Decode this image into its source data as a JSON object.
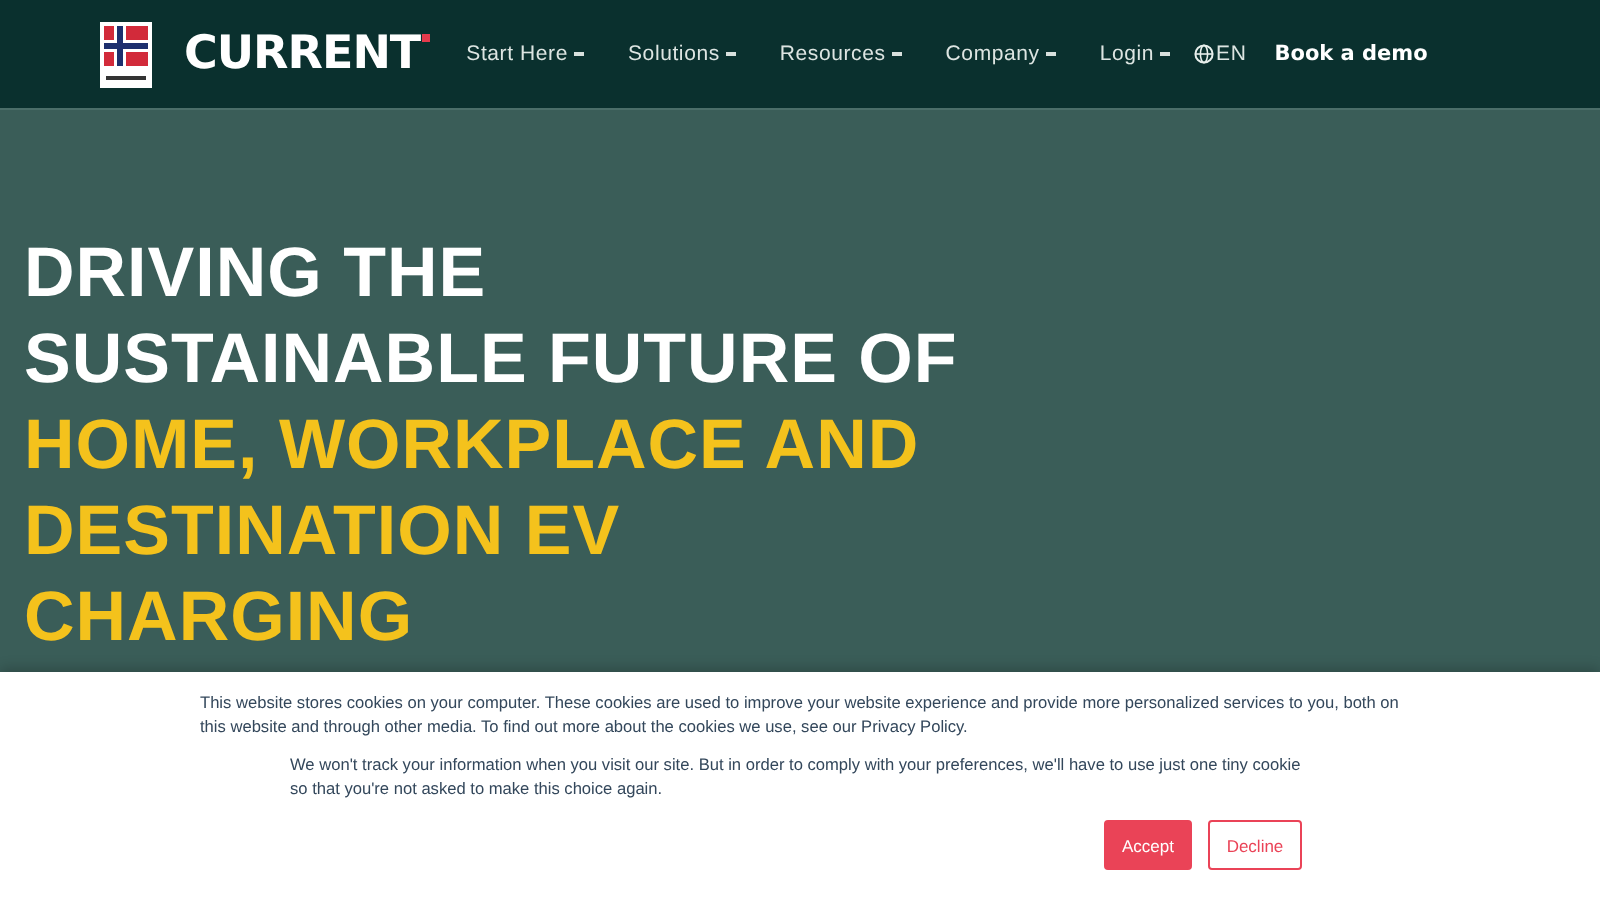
{
  "header": {
    "logo": "CURRENT",
    "nav": [
      {
        "label": "Start Here",
        "dropdown": true
      },
      {
        "label": "Solutions",
        "dropdown": true
      },
      {
        "label": "Resources",
        "dropdown": true
      },
      {
        "label": "Company",
        "dropdown": true
      },
      {
        "label": "Login",
        "dropdown": true
      }
    ],
    "language": "EN",
    "cta": "Book a demo"
  },
  "hero": {
    "lines": [
      {
        "text": "DRIVING THE",
        "highlight": false
      },
      {
        "text": "SUSTAINABLE FUTURE OF",
        "highlight": false
      },
      {
        "text": "HOME, WORKPLACE AND",
        "highlight": true
      },
      {
        "text": "DESTINATION EV",
        "highlight": true
      },
      {
        "text": "CHARGING",
        "highlight": true
      }
    ]
  },
  "cookie_banner": {
    "message": "This website stores cookies on your computer. These cookies are used to improve your website experience and provide more personalized services to you, both on this website and through other media. To find out more about the cookies we use, see our Privacy Policy.",
    "note": "We won't track your information when you visit our site. But in order to comply with your preferences, we'll have to use just one tiny cookie so that you're not asked to make this choice again.",
    "buttons": [
      {
        "label": "Accept",
        "kind": "primary"
      },
      {
        "label": "Decline",
        "kind": "secondary"
      }
    ]
  }
}
